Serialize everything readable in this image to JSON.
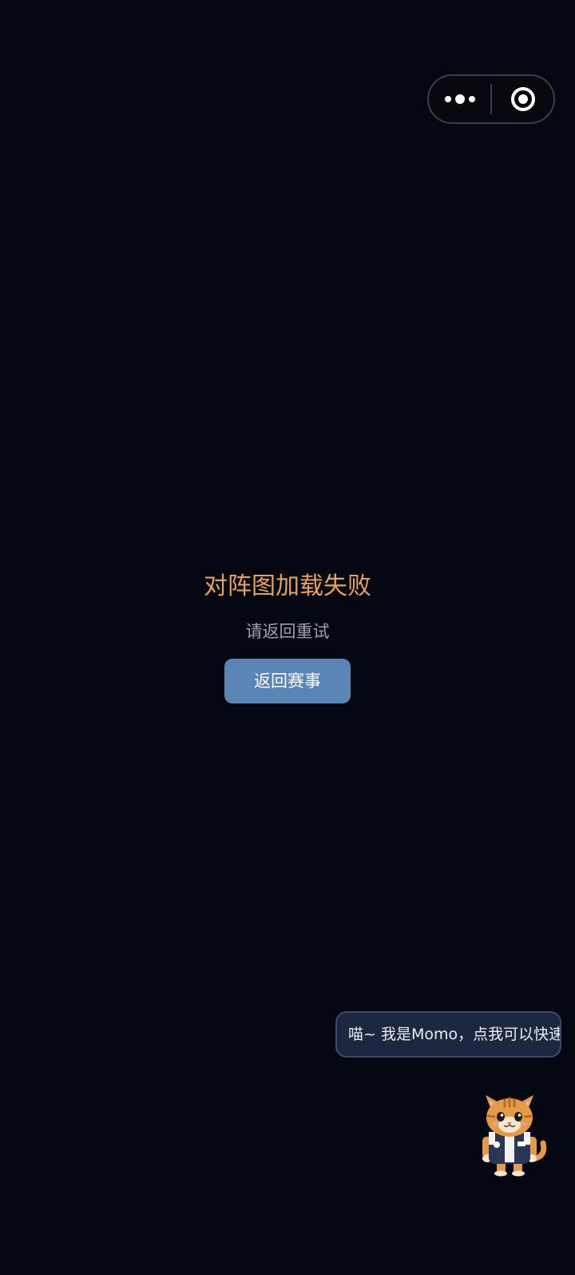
{
  "capsule": {
    "menu_icon": "more-dots-icon",
    "close_icon": "target-circle-icon"
  },
  "error": {
    "title": "对阵图加载失败",
    "subtitle": "请返回重试",
    "button_label": "返回赛事"
  },
  "mascot": {
    "bubble_text": "喵~ 我是Momo，点我可以快速导",
    "icon": "cat-mascot-icon"
  },
  "colors": {
    "background": "#050813",
    "title": "#e6a15a",
    "subtitle": "#9aa1b3",
    "button": "#5a85b4",
    "bubble_bg": "#1e2740",
    "bubble_border": "#3a4a6e"
  }
}
